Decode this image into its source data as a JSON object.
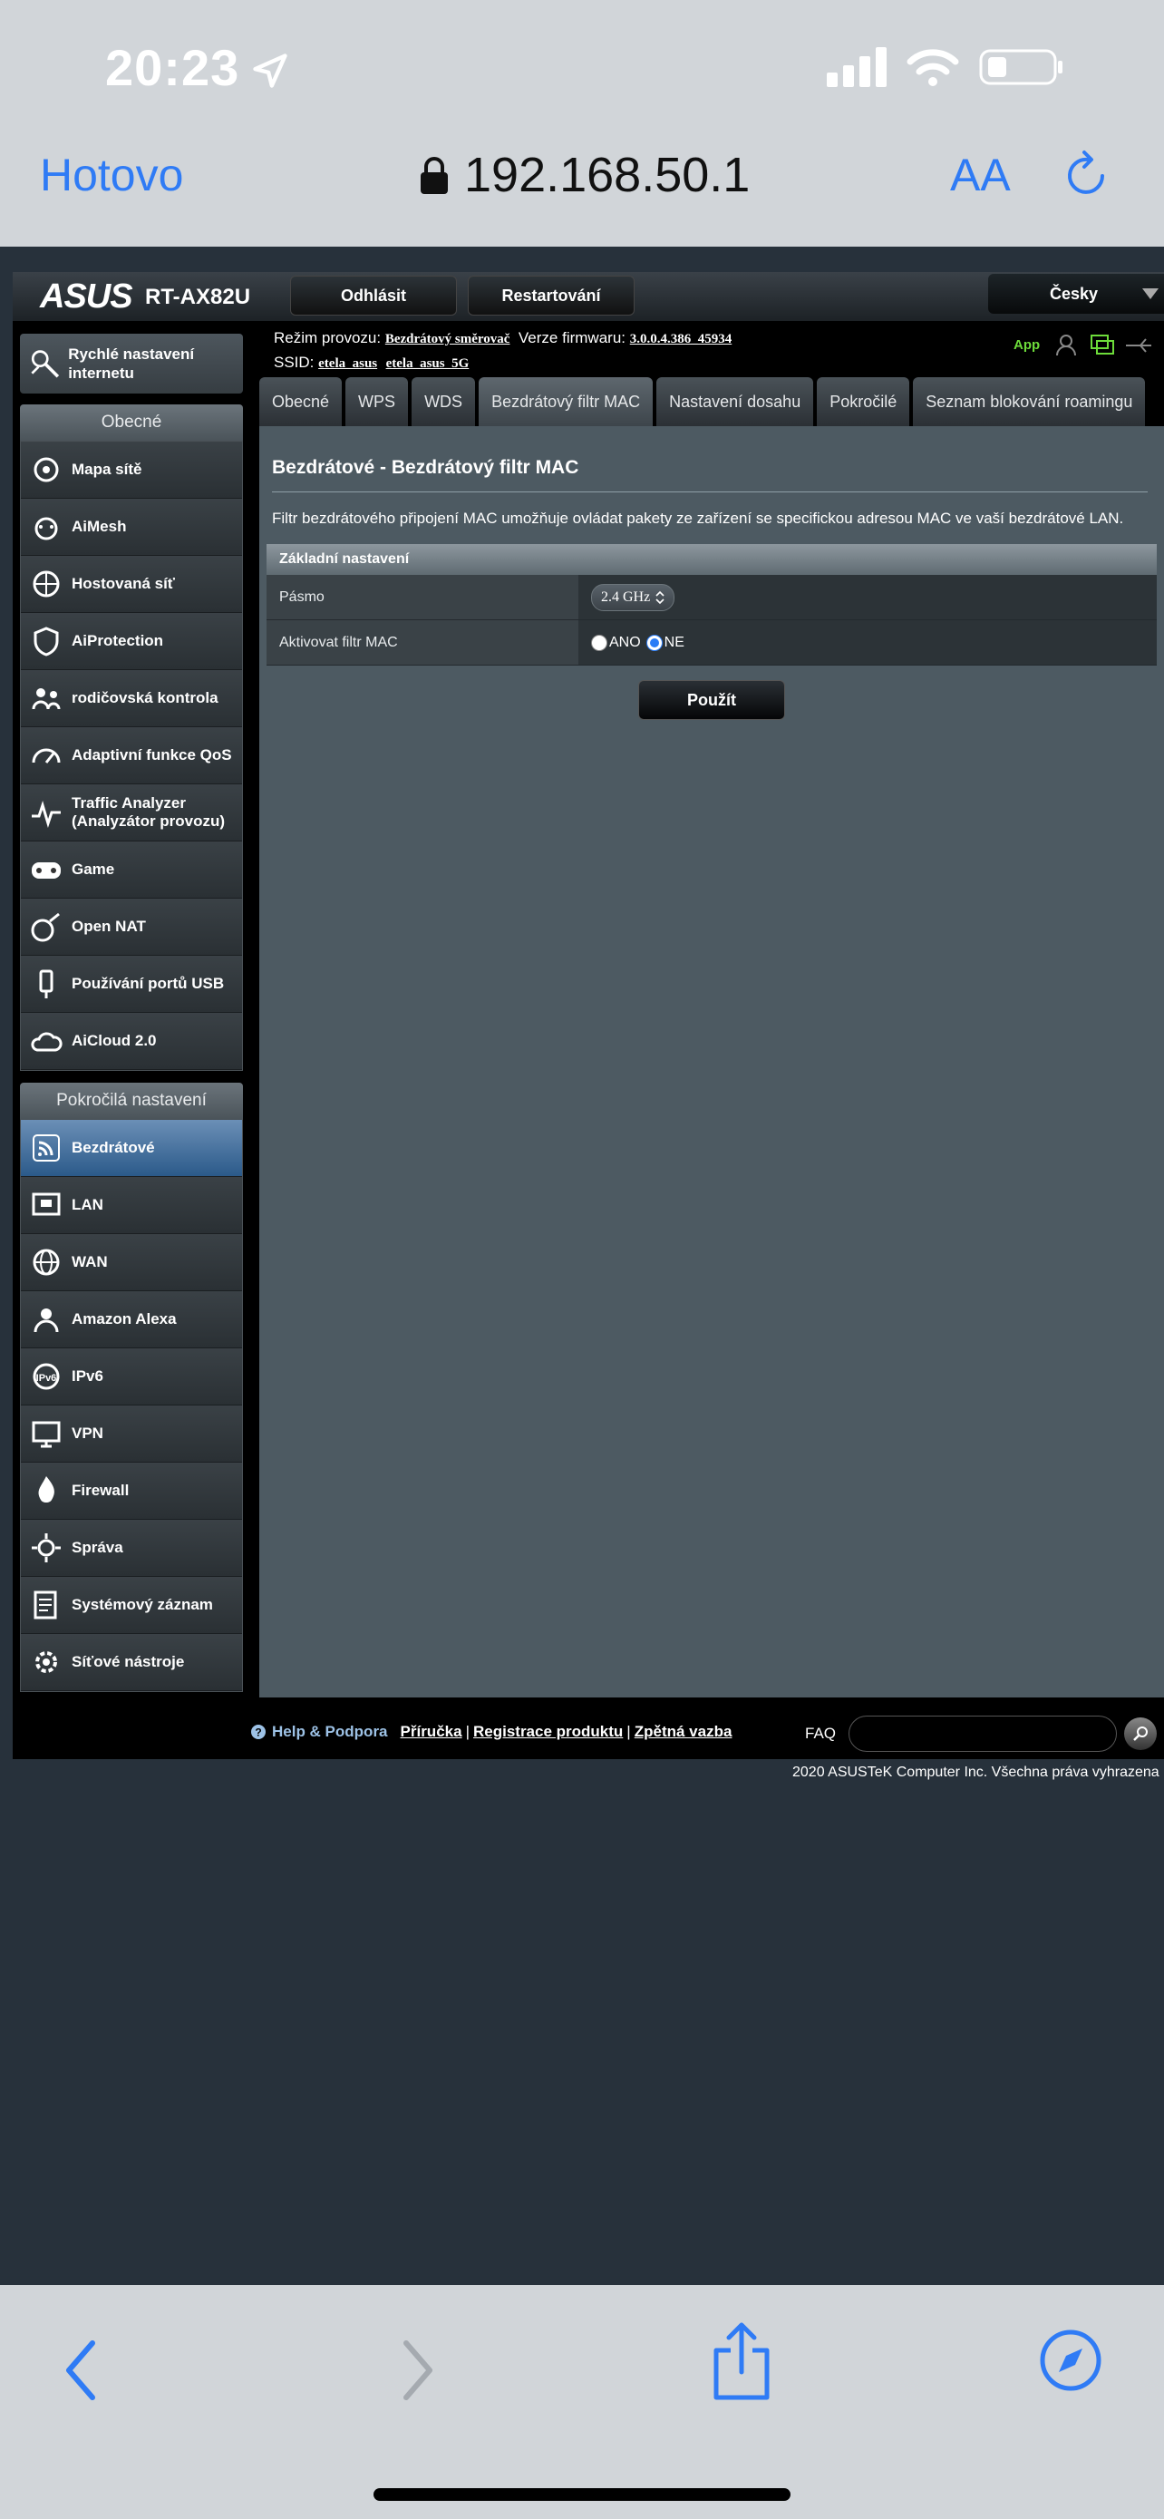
{
  "status_bar": {
    "time": "20:23"
  },
  "safari": {
    "done_label": "Hotovo",
    "url": "192.168.50.1",
    "aa_label": "AA"
  },
  "router": {
    "brand": "ASUS",
    "model": "RT-AX82U",
    "logout_label": "Odhlásit",
    "restart_label": "Restartování",
    "language": "Česky",
    "quick_setup": "Rychlé nastavení internetu",
    "general_head": "Obecné",
    "general_items": [
      {
        "label": "Mapa sítě",
        "icon": "network-map-icon"
      },
      {
        "label": "AiMesh",
        "icon": "aimesh-icon"
      },
      {
        "label": "Hostovaná síť",
        "icon": "guest-network-icon"
      },
      {
        "label": "AiProtection",
        "icon": "shield-icon"
      },
      {
        "label": "rodičovská kontrola",
        "icon": "parental-control-icon"
      },
      {
        "label": "Adaptivní funkce QoS",
        "icon": "qos-gauge-icon"
      },
      {
        "label": "Traffic Analyzer (Analyzátor provozu)",
        "icon": "traffic-analyzer-icon"
      },
      {
        "label": "Game",
        "icon": "gamepad-icon"
      },
      {
        "label": "Open NAT",
        "icon": "open-nat-icon"
      },
      {
        "label": "Používání portů USB",
        "icon": "usb-icon"
      },
      {
        "label": "AiCloud 2.0",
        "icon": "cloud-icon"
      }
    ],
    "advanced_head": "Pokročilá nastavení",
    "advanced_items": [
      {
        "label": "Bezdrátové",
        "icon": "wireless-icon"
      },
      {
        "label": "LAN",
        "icon": "lan-icon"
      },
      {
        "label": "WAN",
        "icon": "globe-icon"
      },
      {
        "label": "Amazon Alexa",
        "icon": "alexa-icon"
      },
      {
        "label": "IPv6",
        "icon": "ipv6-icon"
      },
      {
        "label": "VPN",
        "icon": "vpn-icon"
      },
      {
        "label": "Firewall",
        "icon": "firewall-icon"
      },
      {
        "label": "Správa",
        "icon": "administration-icon"
      },
      {
        "label": "Systémový záznam",
        "icon": "system-log-icon"
      },
      {
        "label": "Síťové nástroje",
        "icon": "network-tools-icon"
      }
    ],
    "info": {
      "mode_label": "Režim provozu:",
      "mode_value": "Bezdrátový směrovač",
      "fw_label": "Verze firmwaru:",
      "fw_value": "3.0.0.4.386_45934",
      "ssid_label": "SSID:",
      "ssid_1": "etela_asus",
      "ssid_2": "etela_asus_5G",
      "app_label": "App"
    },
    "tabs": [
      "Obecné",
      "WPS",
      "WDS",
      "Bezdrátový filtr MAC",
      "Nastavení dosahu",
      "Pokročilé",
      "Seznam blokování roamingu"
    ],
    "active_tab": 3,
    "content": {
      "title": "Bezdrátové - Bezdrátový filtr MAC",
      "description": "Filtr bezdrátového připojení MAC umožňuje ovládat pakety ze zařízení se specifickou adresou MAC ve vaší bezdrátové LAN.",
      "section_head": "Základní nastavení",
      "band_label": "Pásmo",
      "band_value": "2.4 GHz",
      "mac_label": "Aktivovat filtr MAC",
      "yes_label": "ANO",
      "no_label": "NE",
      "apply_label": "Použít"
    },
    "footer": {
      "help": "Help & Podpora",
      "manual": "Příručka",
      "register": "Registrace produktu",
      "feedback": "Zpětná vazba",
      "sep": "|",
      "faq": "FAQ",
      "copyright": "2020 ASUSTeK Computer Inc. Všechna práva vyhrazena"
    }
  },
  "colors": {
    "accent": "#2f7bf5",
    "app_green": "#6ddc3a",
    "active_menu": "#2b5a8a"
  }
}
